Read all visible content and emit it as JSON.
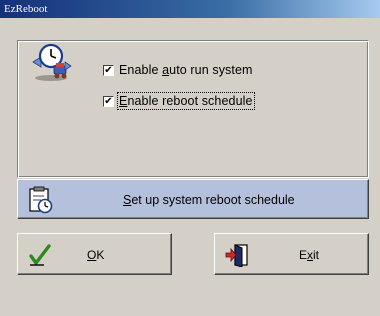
{
  "window": {
    "title": "EzReboot"
  },
  "options": {
    "auto_run": {
      "label_before": "Enable ",
      "label_accel": "a",
      "label_after": "uto run system",
      "checked": true
    },
    "reboot_schedule": {
      "label_before": "",
      "label_accel": "E",
      "label_after": "nable reboot schedule",
      "checked": true
    }
  },
  "schedule_button": {
    "label_accel": "S",
    "label_after": "et up system reboot schedule"
  },
  "ok_button": {
    "label_accel": "O",
    "label_after": "K"
  },
  "exit_button": {
    "label_before": "E",
    "label_accel": "x",
    "label_after": "it"
  },
  "check_mark": "✔",
  "icons": {
    "app": "clock-network-icon",
    "schedule": "clipboard-clock-icon",
    "ok": "green-checkmark-icon",
    "exit": "exit-door-icon"
  },
  "colors": {
    "schedule_button_bg": "#b5c1dc",
    "titlebar": "#14307a",
    "dialog_bg": "#d4d0c8"
  }
}
